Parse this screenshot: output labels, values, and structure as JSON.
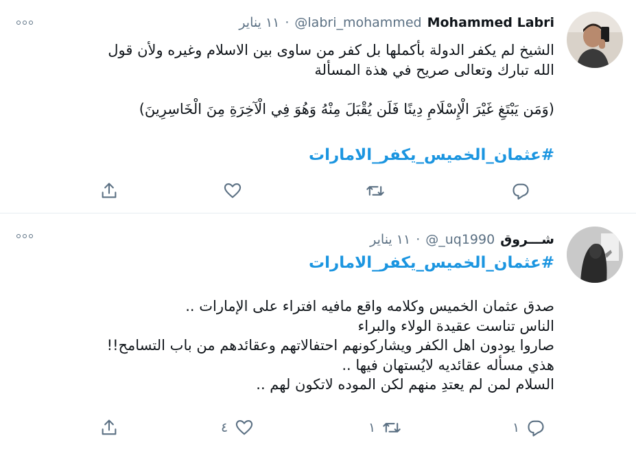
{
  "tweets": [
    {
      "name": "Mohammed Labri",
      "handle": "@labri_mohammed",
      "separator": "·",
      "date": "١١ يناير",
      "lines": [
        "الشيخ لم يكفر الدولة بأكملها بل كفر من ساوى بين الاسلام وغيره ولأن قول",
        "الله تبارك وتعالى صريح في هذة المسألة",
        "",
        "(وَمَن يَبْتَغِ غَيْرَ الْإِسْلَامِ دِينًا فَلَن يُقْبَلَ مِنْهُ وَهُوَ فِي الْآخِرَةِ مِنَ الْخَاسِرِينَ)"
      ],
      "hashtag": "#عثمان_الخميس_يكفر_الامارات",
      "actions": {
        "reply": "",
        "retweet": "",
        "like": "",
        "share": ""
      }
    },
    {
      "name": "شـــروق",
      "handle": "@_uq1990",
      "separator": "·",
      "date": "١١ يناير",
      "hashtag": "#عثمان_الخميس_يكفر_الامارات",
      "lines": [
        "صدق عثمان الخميس وكلامه واقع مافيه افتراء  على الإمارات ..",
        "الناس تناست عقيدة الولاء والبراء",
        "صاروا يودون اهل الكفر ويشاركونهم احتفالاتهم وعقائدهم من باب التسامح!!",
        "هذي مسأله عقائديه لايُستهان فيها ..",
        "السلام لمن لم يعتدِ منهم لكن الموده لاتكون لهم .."
      ],
      "actions": {
        "reply": "١",
        "retweet": "١",
        "like": "٤",
        "share": ""
      }
    }
  ],
  "icons": {
    "more": "more-icon",
    "reply": "reply-icon",
    "retweet": "retweet-icon",
    "like": "like-icon",
    "share": "share-icon"
  },
  "colors": {
    "text": "#0f1419",
    "secondary": "#5b7083",
    "hashtag": "#1b95e0",
    "divider": "#e6ecf0"
  }
}
